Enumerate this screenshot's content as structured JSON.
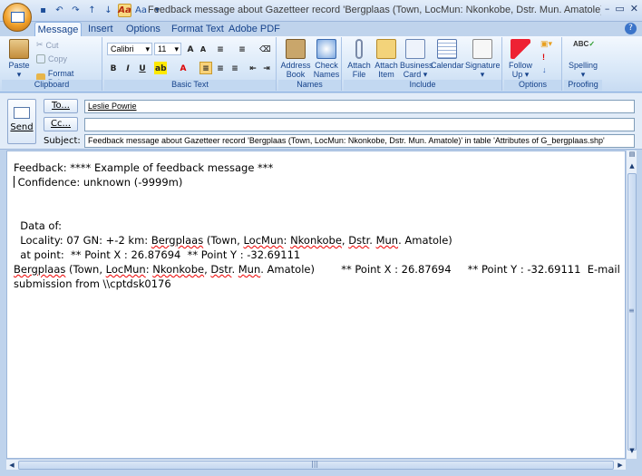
{
  "window": {
    "title": "Feedback message about Gazetteer record 'Bergplaas (Town, LocMun: Nkonkobe, Dstr. Mun. Amatole)' in table 'Attributes of G_ber...M...",
    "controls": [
      "–",
      "▭",
      "✕"
    ]
  },
  "tabs": [
    "Message",
    "Insert",
    "Options",
    "Format Text",
    "Adobe PDF"
  ],
  "ribbon": {
    "clipboard": {
      "label": "Clipboard",
      "paste": "Paste",
      "cut": "Cut",
      "copy": "Copy",
      "format_painter": "Format Painter"
    },
    "basic_text": {
      "label": "Basic Text",
      "font": "Calibri",
      "size": "11"
    },
    "names": {
      "label": "Names",
      "address_book": [
        "Address",
        "Book"
      ],
      "check_names": [
        "Check",
        "Names"
      ]
    },
    "include": {
      "label": "Include",
      "attach_file": [
        "Attach",
        "File"
      ],
      "attach_item": [
        "Attach",
        "Item"
      ],
      "business_card": [
        "Business",
        "Card"
      ],
      "calendar": "Calendar",
      "signature": "Signature"
    },
    "options": {
      "label": "Options",
      "follow_up": [
        "Follow",
        "Up"
      ]
    },
    "proofing": {
      "label": "Proofing",
      "spelling": "Spelling"
    }
  },
  "header": {
    "send": "Send",
    "to_btn": "To...",
    "cc_btn": "Cc...",
    "subject_label": "Subject:",
    "to_value": "Leslie Powrie",
    "cc_value": "",
    "subject_value": "Feedback message about Gazetteer record 'Bergplaas (Town, LocMun: Nkonkobe, Dstr. Mun. Amatole)' in table 'Attributes of G_bergplaas.shp'"
  },
  "body": {
    "l1": "Feedback: **** Example of feedback message ***",
    "l2": " Confidence: unknown (-9999m)",
    "l3": "  Data of:",
    "l4a": "  Locality: 07 GN: +-2 km: ",
    "l4b": "Bergplaas",
    "l4c": " (Town, ",
    "l4d": "LocMun",
    "l4e": ": ",
    "l4f": "Nkonkobe",
    "l4g": ", ",
    "l4h": "Dstr",
    "l4i": ". ",
    "l4j": "Mun",
    "l4k": ". Amatole)",
    "l5": "  at point:  ** Point X : 26.87694  ** Point Y : -32.69111",
    "l6a": "Bergplaas",
    "l6b": " (Town, ",
    "l6c": "LocMun",
    "l6d": ": ",
    "l6e": "Nkonkobe",
    "l6f": ", ",
    "l6g": "Dstr",
    "l6h": ". ",
    "l6i": "Mun",
    "l6j": ". Amatole)        ** Point X : 26.87694     ** Point Y : -32.69111  E-mail",
    "l7": "submission from \\\\cptdsk0176"
  }
}
